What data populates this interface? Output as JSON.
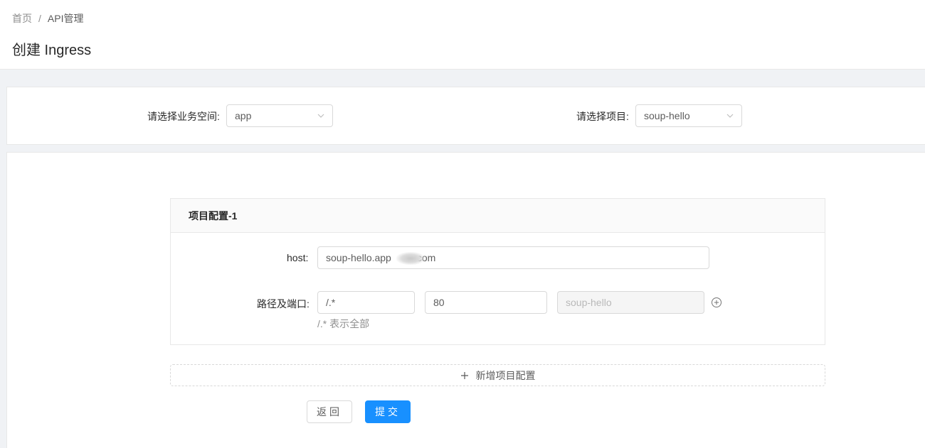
{
  "breadcrumb": {
    "home": "首页",
    "separator": "/",
    "current": "API管理"
  },
  "page_title": "创建 Ingress",
  "filters": {
    "space_label": "请选择业务空间:",
    "space_value": "app",
    "project_label": "请选择项目:",
    "project_value": "soup-hello"
  },
  "config": {
    "title": "项目配置-1",
    "host_label": "host:",
    "host_value": "soup-hello.app",
    "host_value_suffix": "com",
    "path_label": "路径及端口:",
    "path_value": "/.*",
    "port_value": "80",
    "service_value": "soup-hello",
    "path_hint": "/.* 表示全部"
  },
  "add_config_label": "新增项目配置",
  "actions": {
    "back_label": "返回",
    "submit_label": "提交"
  },
  "colors": {
    "primary": "#1890ff",
    "background": "#f0f2f5"
  }
}
